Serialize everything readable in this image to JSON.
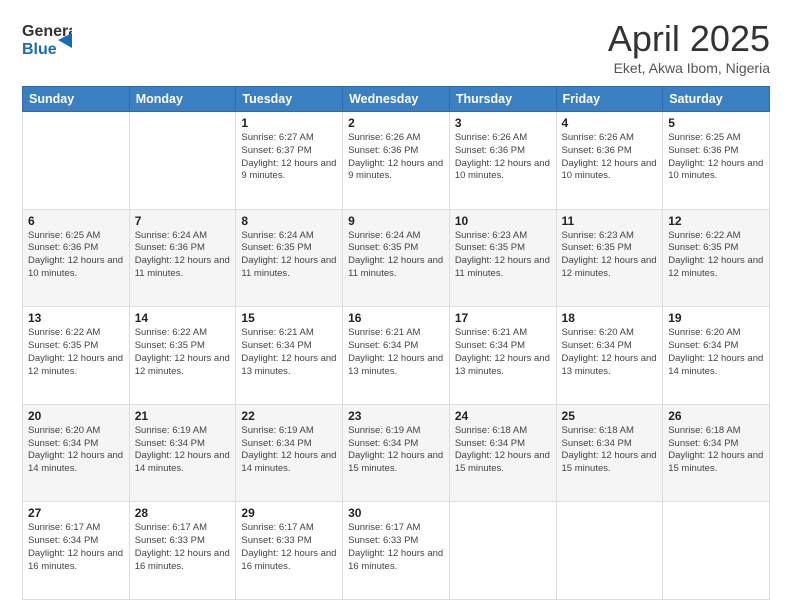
{
  "header": {
    "logo_line1": "General",
    "logo_line2": "Blue",
    "main_title": "April 2025",
    "subtitle": "Eket, Akwa Ibom, Nigeria"
  },
  "weekdays": [
    "Sunday",
    "Monday",
    "Tuesday",
    "Wednesday",
    "Thursday",
    "Friday",
    "Saturday"
  ],
  "weeks": [
    [
      {
        "day": "",
        "info": ""
      },
      {
        "day": "",
        "info": ""
      },
      {
        "day": "1",
        "info": "Sunrise: 6:27 AM\nSunset: 6:37 PM\nDaylight: 12 hours and 9 minutes."
      },
      {
        "day": "2",
        "info": "Sunrise: 6:26 AM\nSunset: 6:36 PM\nDaylight: 12 hours and 9 minutes."
      },
      {
        "day": "3",
        "info": "Sunrise: 6:26 AM\nSunset: 6:36 PM\nDaylight: 12 hours and 10 minutes."
      },
      {
        "day": "4",
        "info": "Sunrise: 6:26 AM\nSunset: 6:36 PM\nDaylight: 12 hours and 10 minutes."
      },
      {
        "day": "5",
        "info": "Sunrise: 6:25 AM\nSunset: 6:36 PM\nDaylight: 12 hours and 10 minutes."
      }
    ],
    [
      {
        "day": "6",
        "info": "Sunrise: 6:25 AM\nSunset: 6:36 PM\nDaylight: 12 hours and 10 minutes."
      },
      {
        "day": "7",
        "info": "Sunrise: 6:24 AM\nSunset: 6:36 PM\nDaylight: 12 hours and 11 minutes."
      },
      {
        "day": "8",
        "info": "Sunrise: 6:24 AM\nSunset: 6:35 PM\nDaylight: 12 hours and 11 minutes."
      },
      {
        "day": "9",
        "info": "Sunrise: 6:24 AM\nSunset: 6:35 PM\nDaylight: 12 hours and 11 minutes."
      },
      {
        "day": "10",
        "info": "Sunrise: 6:23 AM\nSunset: 6:35 PM\nDaylight: 12 hours and 11 minutes."
      },
      {
        "day": "11",
        "info": "Sunrise: 6:23 AM\nSunset: 6:35 PM\nDaylight: 12 hours and 12 minutes."
      },
      {
        "day": "12",
        "info": "Sunrise: 6:22 AM\nSunset: 6:35 PM\nDaylight: 12 hours and 12 minutes."
      }
    ],
    [
      {
        "day": "13",
        "info": "Sunrise: 6:22 AM\nSunset: 6:35 PM\nDaylight: 12 hours and 12 minutes."
      },
      {
        "day": "14",
        "info": "Sunrise: 6:22 AM\nSunset: 6:35 PM\nDaylight: 12 hours and 12 minutes."
      },
      {
        "day": "15",
        "info": "Sunrise: 6:21 AM\nSunset: 6:34 PM\nDaylight: 12 hours and 13 minutes."
      },
      {
        "day": "16",
        "info": "Sunrise: 6:21 AM\nSunset: 6:34 PM\nDaylight: 12 hours and 13 minutes."
      },
      {
        "day": "17",
        "info": "Sunrise: 6:21 AM\nSunset: 6:34 PM\nDaylight: 12 hours and 13 minutes."
      },
      {
        "day": "18",
        "info": "Sunrise: 6:20 AM\nSunset: 6:34 PM\nDaylight: 12 hours and 13 minutes."
      },
      {
        "day": "19",
        "info": "Sunrise: 6:20 AM\nSunset: 6:34 PM\nDaylight: 12 hours and 14 minutes."
      }
    ],
    [
      {
        "day": "20",
        "info": "Sunrise: 6:20 AM\nSunset: 6:34 PM\nDaylight: 12 hours and 14 minutes."
      },
      {
        "day": "21",
        "info": "Sunrise: 6:19 AM\nSunset: 6:34 PM\nDaylight: 12 hours and 14 minutes."
      },
      {
        "day": "22",
        "info": "Sunrise: 6:19 AM\nSunset: 6:34 PM\nDaylight: 12 hours and 14 minutes."
      },
      {
        "day": "23",
        "info": "Sunrise: 6:19 AM\nSunset: 6:34 PM\nDaylight: 12 hours and 15 minutes."
      },
      {
        "day": "24",
        "info": "Sunrise: 6:18 AM\nSunset: 6:34 PM\nDaylight: 12 hours and 15 minutes."
      },
      {
        "day": "25",
        "info": "Sunrise: 6:18 AM\nSunset: 6:34 PM\nDaylight: 12 hours and 15 minutes."
      },
      {
        "day": "26",
        "info": "Sunrise: 6:18 AM\nSunset: 6:34 PM\nDaylight: 12 hours and 15 minutes."
      }
    ],
    [
      {
        "day": "27",
        "info": "Sunrise: 6:17 AM\nSunset: 6:34 PM\nDaylight: 12 hours and 16 minutes."
      },
      {
        "day": "28",
        "info": "Sunrise: 6:17 AM\nSunset: 6:33 PM\nDaylight: 12 hours and 16 minutes."
      },
      {
        "day": "29",
        "info": "Sunrise: 6:17 AM\nSunset: 6:33 PM\nDaylight: 12 hours and 16 minutes."
      },
      {
        "day": "30",
        "info": "Sunrise: 6:17 AM\nSunset: 6:33 PM\nDaylight: 12 hours and 16 minutes."
      },
      {
        "day": "",
        "info": ""
      },
      {
        "day": "",
        "info": ""
      },
      {
        "day": "",
        "info": ""
      }
    ]
  ]
}
